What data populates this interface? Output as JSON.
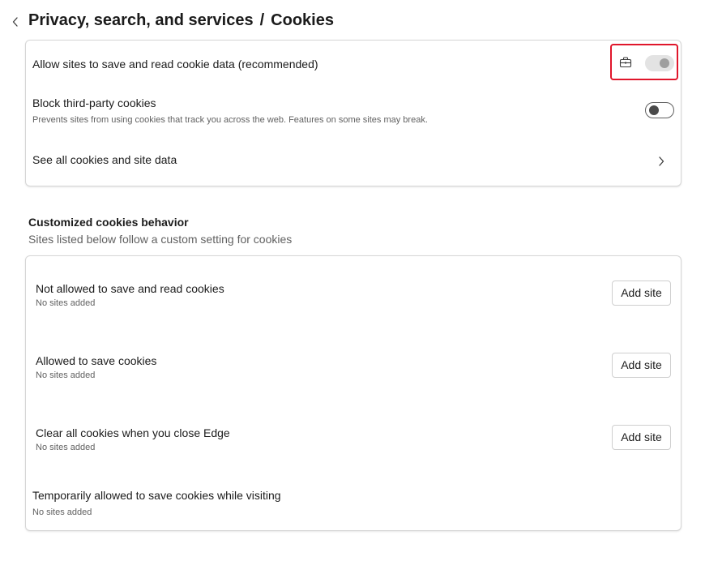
{
  "header": {
    "parent": "Privacy, search, and services",
    "separator": "/",
    "title": "Cookies"
  },
  "main_card": {
    "allow_cookies": {
      "label": "Allow sites to save and read cookie data (recommended)",
      "state": "on-disabled",
      "managed_icon": "briefcase-icon"
    },
    "block_third_party": {
      "label": "Block third-party cookies",
      "description": "Prevents sites from using cookies that track you across the web. Features on some sites may break.",
      "state": "off"
    },
    "see_all": {
      "label": "See all cookies and site data"
    }
  },
  "custom_section": {
    "title": "Customized cookies behavior",
    "subtitle": "Sites listed below follow a custom setting for cookies"
  },
  "custom_card": {
    "rows": [
      {
        "label": "Not allowed to save and read cookies",
        "status": "No sites added",
        "button": "Add site"
      },
      {
        "label": "Allowed to save cookies",
        "status": "No sites added",
        "button": "Add site"
      },
      {
        "label": "Clear all cookies when you close Edge",
        "status": "No sites added",
        "button": "Add site"
      },
      {
        "label": "Temporarily allowed to save cookies while visiting",
        "status": "No sites added"
      }
    ]
  },
  "colors": {
    "highlight_border": "#e0162b",
    "toggle_disabled_bg": "#e3e3e3",
    "text_primary": "#1b1b1b",
    "text_secondary": "#616161"
  }
}
